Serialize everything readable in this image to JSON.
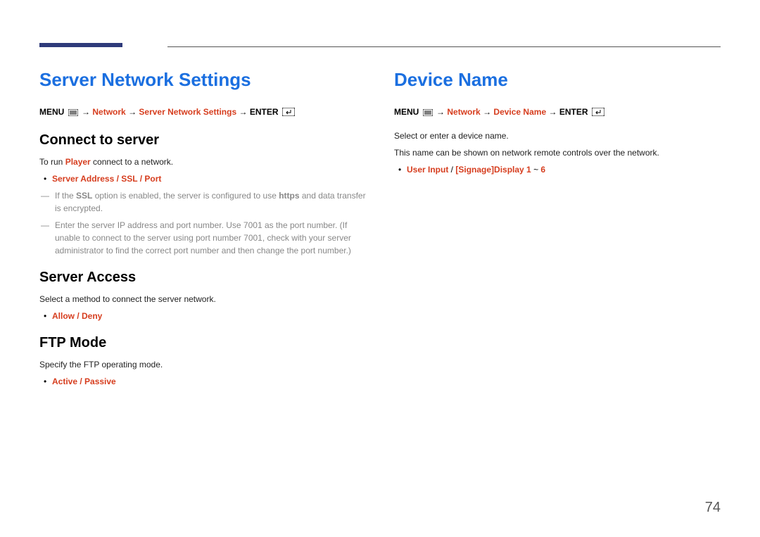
{
  "page_number": "74",
  "left": {
    "title": "Server Network Settings",
    "bc_menu": "MENU",
    "bc_arrow": " → ",
    "bc_network": "Network",
    "bc_sns": "Server Network Settings",
    "bc_enter": "ENTER",
    "connect_heading": "Connect to server",
    "connect_run_pre": "To run ",
    "connect_run_player": "Player",
    "connect_run_post": " connect to a network.",
    "connect_opts": "Server Address / SSL / Port",
    "ssl_pre": "If the ",
    "ssl_bold": "SSL",
    "ssl_mid": " option is enabled, the server is configured to use ",
    "ssl_https": "https",
    "ssl_post": " and data transfer is encrypted.",
    "ip_note": "Enter the server IP address and port number. Use 7001 as the port number. (If unable to connect to the server using port number 7001, check with your server administrator to find the correct port number and then change the port number.)",
    "access_heading": "Server Access",
    "access_body": "Select a method to connect the server network.",
    "access_opts": "Allow / Deny",
    "ftp_heading": "FTP Mode",
    "ftp_body": "Specify the FTP operating mode.",
    "ftp_opts": "Active / Passive"
  },
  "right": {
    "title": "Device Name",
    "bc_menu": "MENU",
    "bc_arrow": " → ",
    "bc_network": "Network",
    "bc_dn": "Device Name",
    "bc_enter": "ENTER",
    "body1": "Select or enter a device name.",
    "body2": "This name can be shown on network remote controls over the network.",
    "opts_pre": "User Input",
    "opts_sep": " / ",
    "opts_mid": "[Signage]Display 1",
    "opts_post": " ~ ",
    "opts_end": "6"
  }
}
